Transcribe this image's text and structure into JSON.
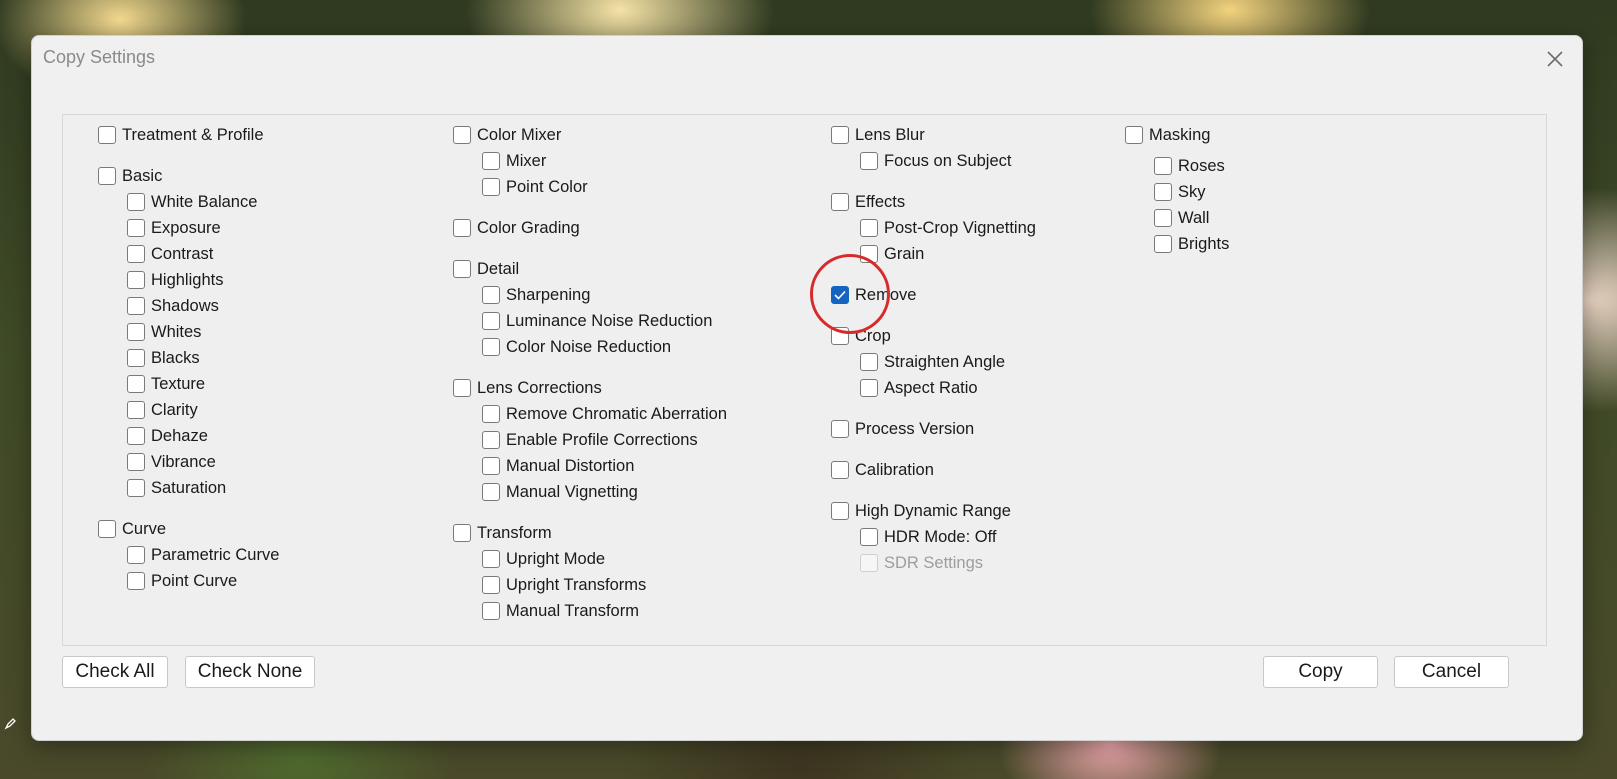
{
  "window": {
    "title": "Copy Settings"
  },
  "checkboxes": [
    {
      "label": "Treatment & Profile",
      "checked": false
    },
    {
      "label": "Basic",
      "checked": false
    },
    {
      "label": "White Balance",
      "checked": false
    },
    {
      "label": "Exposure",
      "checked": false
    },
    {
      "label": "Contrast",
      "checked": false
    },
    {
      "label": "Highlights",
      "checked": false
    },
    {
      "label": "Shadows",
      "checked": false
    },
    {
      "label": "Whites",
      "checked": false
    },
    {
      "label": "Blacks",
      "checked": false
    },
    {
      "label": "Texture",
      "checked": false
    },
    {
      "label": "Clarity",
      "checked": false
    },
    {
      "label": "Dehaze",
      "checked": false
    },
    {
      "label": "Vibrance",
      "checked": false
    },
    {
      "label": "Saturation",
      "checked": false
    },
    {
      "label": "Curve",
      "checked": false
    },
    {
      "label": "Parametric Curve",
      "checked": false
    },
    {
      "label": "Point Curve",
      "checked": false
    },
    {
      "label": "Color Mixer",
      "checked": false
    },
    {
      "label": "Mixer",
      "checked": false
    },
    {
      "label": "Point Color",
      "checked": false
    },
    {
      "label": "Color Grading",
      "checked": false
    },
    {
      "label": "Detail",
      "checked": false
    },
    {
      "label": "Sharpening",
      "checked": false
    },
    {
      "label": "Luminance Noise Reduction",
      "checked": false
    },
    {
      "label": "Color Noise Reduction",
      "checked": false
    },
    {
      "label": "Lens Corrections",
      "checked": false
    },
    {
      "label": "Remove Chromatic Aberration",
      "checked": false
    },
    {
      "label": "Enable Profile Corrections",
      "checked": false
    },
    {
      "label": "Manual Distortion",
      "checked": false
    },
    {
      "label": "Manual Vignetting",
      "checked": false
    },
    {
      "label": "Transform",
      "checked": false
    },
    {
      "label": "Upright Mode",
      "checked": false
    },
    {
      "label": "Upright Transforms",
      "checked": false
    },
    {
      "label": "Manual Transform",
      "checked": false
    },
    {
      "label": "Lens Blur",
      "checked": false
    },
    {
      "label": "Focus on Subject",
      "checked": false
    },
    {
      "label": "Effects",
      "checked": false
    },
    {
      "label": "Post-Crop Vignetting",
      "checked": false
    },
    {
      "label": "Grain",
      "checked": false
    },
    {
      "label": "Remove",
      "checked": true
    },
    {
      "label": "Crop",
      "checked": false
    },
    {
      "label": "Straighten Angle",
      "checked": false
    },
    {
      "label": "Aspect Ratio",
      "checked": false
    },
    {
      "label": "Process Version",
      "checked": false
    },
    {
      "label": "Calibration",
      "checked": false
    },
    {
      "label": "High Dynamic Range",
      "checked": false
    },
    {
      "label": "HDR Mode: Off",
      "checked": false
    },
    {
      "label": "SDR Settings",
      "checked": false,
      "disabled": true
    },
    {
      "label": "Masking",
      "checked": false
    },
    {
      "label": "Roses",
      "checked": false
    },
    {
      "label": "Sky",
      "checked": false
    },
    {
      "label": "Wall",
      "checked": false
    },
    {
      "label": "Brights",
      "checked": false
    }
  ],
  "buttons": {
    "check_all": "Check All",
    "check_none": "Check None",
    "copy": "Copy",
    "cancel": "Cancel"
  },
  "colors": {
    "accent": "#1565c0",
    "annotation_ring": "#d72a2a"
  }
}
